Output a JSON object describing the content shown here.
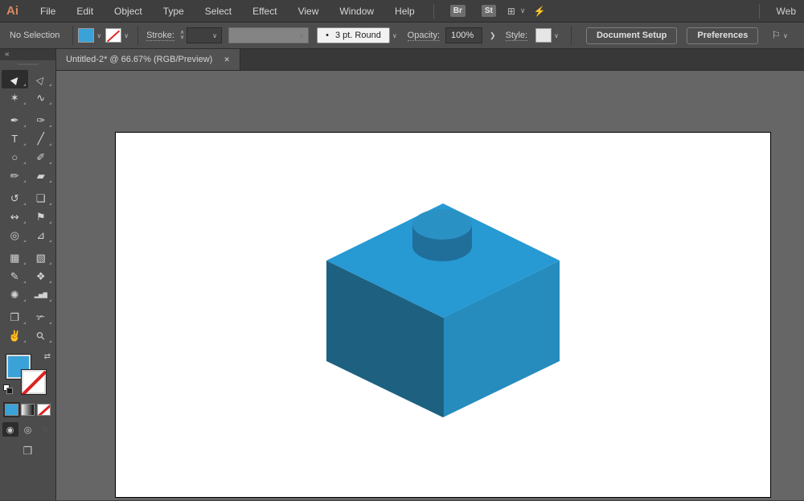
{
  "menubar": {
    "logo": "Ai",
    "items": [
      "File",
      "Edit",
      "Object",
      "Type",
      "Select",
      "Effect",
      "View",
      "Window",
      "Help"
    ],
    "bridge_button": "Br",
    "stock_button": "St",
    "arrange_documents_icon": "⊞",
    "arrange_chevron": "∨",
    "sync_icon": "⚡",
    "workspace": "Web"
  },
  "controlbar": {
    "selection_status": "No Selection",
    "fill_swatch_color": "#3AA2D8",
    "fill_chevron": "∨",
    "stroke_chevron": "∨",
    "stroke_label": "Stroke:",
    "stepper_up": "∧",
    "stepper_down": "∨",
    "brush_bullet": "•",
    "brush_name": "3 pt. Round",
    "opacity_label": "Opacity:",
    "opacity_value": "100%",
    "opacity_arrow": "❯",
    "style_label": "Style:",
    "document_setup_button": "Document Setup",
    "preferences_button": "Preferences",
    "workspace_tool_icon": "⚐",
    "workspace_tool_chevron": "∨"
  },
  "tabbar": {
    "document_title": "Untitled-2* @ 66.67% (RGB/Preview)",
    "close_glyph": "✕"
  },
  "toolbar": {
    "collapse_glyph": "«",
    "tool_groups": [
      [
        {
          "name": "selection-tool",
          "glyph": "▶",
          "selected": true
        },
        {
          "name": "direct-selection-tool",
          "glyph": "▷"
        },
        {
          "name": "magic-wand-tool",
          "glyph": "✶"
        },
        {
          "name": "lasso-tool",
          "glyph": "∿"
        }
      ],
      [
        {
          "name": "pen-tool",
          "glyph": "✒"
        },
        {
          "name": "curvature-tool",
          "glyph": "✑"
        },
        {
          "name": "type-tool",
          "glyph": "T"
        },
        {
          "name": "line-segment-tool",
          "glyph": "╱"
        },
        {
          "name": "ellipse-tool",
          "glyph": "○"
        },
        {
          "name": "paintbrush-tool",
          "glyph": "✐"
        },
        {
          "name": "shaper-tool",
          "glyph": "✏"
        },
        {
          "name": "eraser-tool",
          "glyph": "▰"
        }
      ],
      [
        {
          "name": "rotate-tool",
          "glyph": "↺"
        },
        {
          "name": "scale-tool",
          "glyph": "❏"
        },
        {
          "name": "width-tool",
          "glyph": "↭"
        },
        {
          "name": "puppet-warp-tool",
          "glyph": "⚑"
        },
        {
          "name": "shape-builder-tool",
          "glyph": "◎"
        },
        {
          "name": "perspective-grid-tool",
          "glyph": "⊿"
        }
      ],
      [
        {
          "name": "mesh-tool",
          "glyph": "▦"
        },
        {
          "name": "gradient-tool",
          "glyph": "▧"
        },
        {
          "name": "eyedropper-tool",
          "glyph": "✎"
        },
        {
          "name": "blend-tool",
          "glyph": "❖"
        },
        {
          "name": "symbol-sprayer-tool",
          "glyph": "✺"
        },
        {
          "name": "column-graph-tool",
          "glyph": "▂▅▇"
        }
      ],
      [
        {
          "name": "artboard-tool",
          "glyph": "❐"
        },
        {
          "name": "slice-tool",
          "glyph": "✃"
        },
        {
          "name": "hand-tool",
          "glyph": "✌"
        },
        {
          "name": "zoom-tool",
          "glyph": "⚲"
        }
      ]
    ],
    "fill_color": "#3AA2D8",
    "stroke_value": "none",
    "swap_glyph": "⇄",
    "draw_modes": [
      {
        "name": "draw-normal",
        "glyph": "◉",
        "selected": true
      },
      {
        "name": "draw-behind",
        "glyph": "◎",
        "selected": false
      },
      {
        "name": "draw-inside",
        "glyph": "◌",
        "selected": false,
        "disabled": true
      }
    ],
    "screen_mode_glyph": "❒"
  },
  "canvas": {
    "background": "#666666",
    "artboard_color": "#FFFFFF",
    "brick_colors": {
      "top": "#2799D3",
      "left": "#1E6080",
      "right": "#268CBE",
      "stud_top": "#2A91C4",
      "stud_side": "#1F6F9A",
      "edge": "#1A5E80"
    }
  }
}
